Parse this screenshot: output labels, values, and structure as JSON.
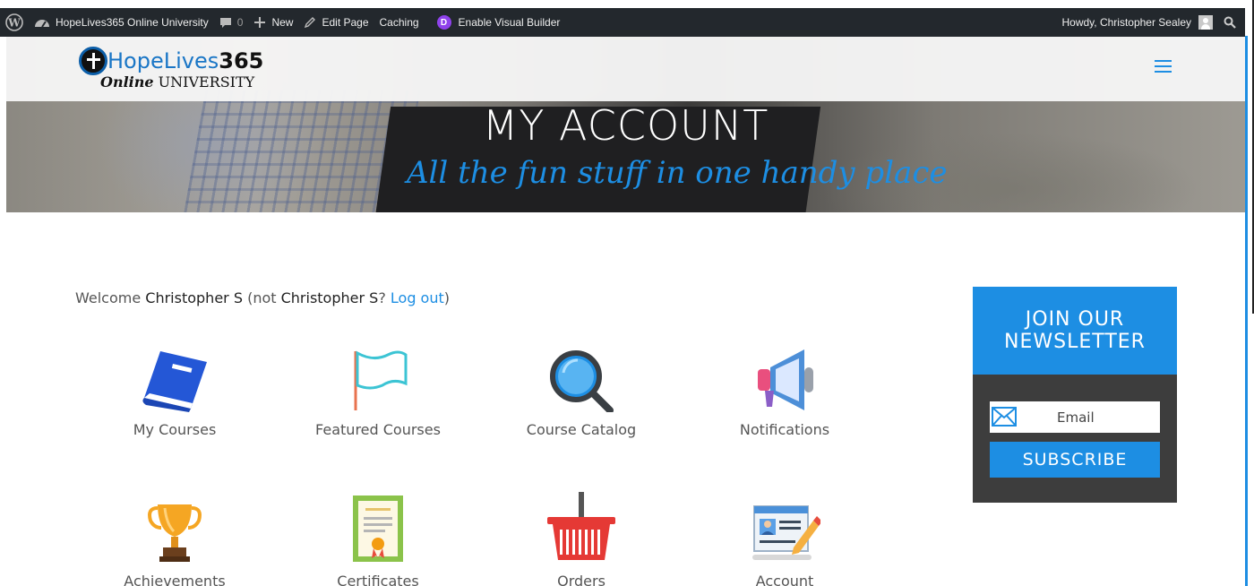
{
  "adminbar": {
    "site_name": "HopeLives365 Online University",
    "comments_count": "0",
    "new_label": "New",
    "edit_label": "Edit Page",
    "caching_label": "Caching",
    "divi_badge": "D",
    "visual_builder_label": "Enable Visual Builder",
    "howdy": "Howdy, Christopher Sealey",
    "icons": [
      "wordpress-icon",
      "dashboard-icon",
      "comment-icon",
      "plus-icon",
      "pencil-icon",
      "divi-icon",
      "search-icon"
    ]
  },
  "logo": {
    "top_a": "HopeLives",
    "top_b": "365",
    "bottom_a": "Online",
    "bottom_b": " UNIVERSITY"
  },
  "hero": {
    "title": "MY ACCOUNT",
    "subtitle": "All the fun stuff in one handy place"
  },
  "welcome": {
    "prefix": "Welcome ",
    "name": "Christopher S",
    "middle": " (not ",
    "name2": "Christopher S",
    "suffix": "? ",
    "logout": "Log out",
    "close": ")"
  },
  "tiles": [
    {
      "label": "My Courses",
      "icon": "book-icon"
    },
    {
      "label": "Featured Courses",
      "icon": "flag-icon"
    },
    {
      "label": "Course Catalog",
      "icon": "magnifier-icon"
    },
    {
      "label": "Notifications",
      "icon": "megaphone-icon"
    },
    {
      "label": "Achievements",
      "icon": "trophy-icon"
    },
    {
      "label": "Certificates",
      "icon": "certificate-icon"
    },
    {
      "label": "Orders",
      "icon": "basket-icon"
    },
    {
      "label": "Account",
      "icon": "id-card-icon"
    }
  ],
  "newsletter": {
    "title_line1": "JOIN OUR",
    "title_line2": "NEWSLETTER",
    "email_placeholder": "Email",
    "subscribe": "SUBSCRIBE"
  },
  "colors": {
    "accent": "#1d8ee3",
    "adminbar": "#23282d",
    "newsletter_bg": "#3d3d3d",
    "divi": "#8f42ec"
  }
}
